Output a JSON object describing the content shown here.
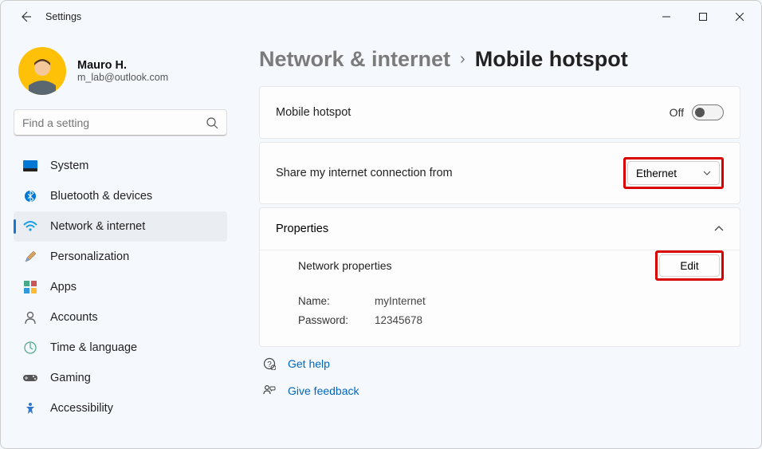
{
  "window": {
    "title": "Settings"
  },
  "user": {
    "name": "Mauro H.",
    "email": "m_lab@outlook.com"
  },
  "search": {
    "placeholder": "Find a setting"
  },
  "nav": {
    "items": [
      {
        "label": "System"
      },
      {
        "label": "Bluetooth & devices"
      },
      {
        "label": "Network & internet"
      },
      {
        "label": "Personalization"
      },
      {
        "label": "Apps"
      },
      {
        "label": "Accounts"
      },
      {
        "label": "Time & language"
      },
      {
        "label": "Gaming"
      },
      {
        "label": "Accessibility"
      }
    ],
    "active_index": 2
  },
  "breadcrumb": {
    "parent": "Network & internet",
    "current": "Mobile hotspot"
  },
  "hotspot": {
    "toggle_label": "Mobile hotspot",
    "toggle_state": "Off",
    "share_label": "Share my internet connection from",
    "share_value": "Ethernet",
    "properties_title": "Properties",
    "network_properties_label": "Network properties",
    "edit_label": "Edit",
    "name_label": "Name:",
    "name_value": "myInternet",
    "password_label": "Password:",
    "password_value": "12345678"
  },
  "footer": {
    "help": "Get help",
    "feedback": "Give feedback"
  }
}
